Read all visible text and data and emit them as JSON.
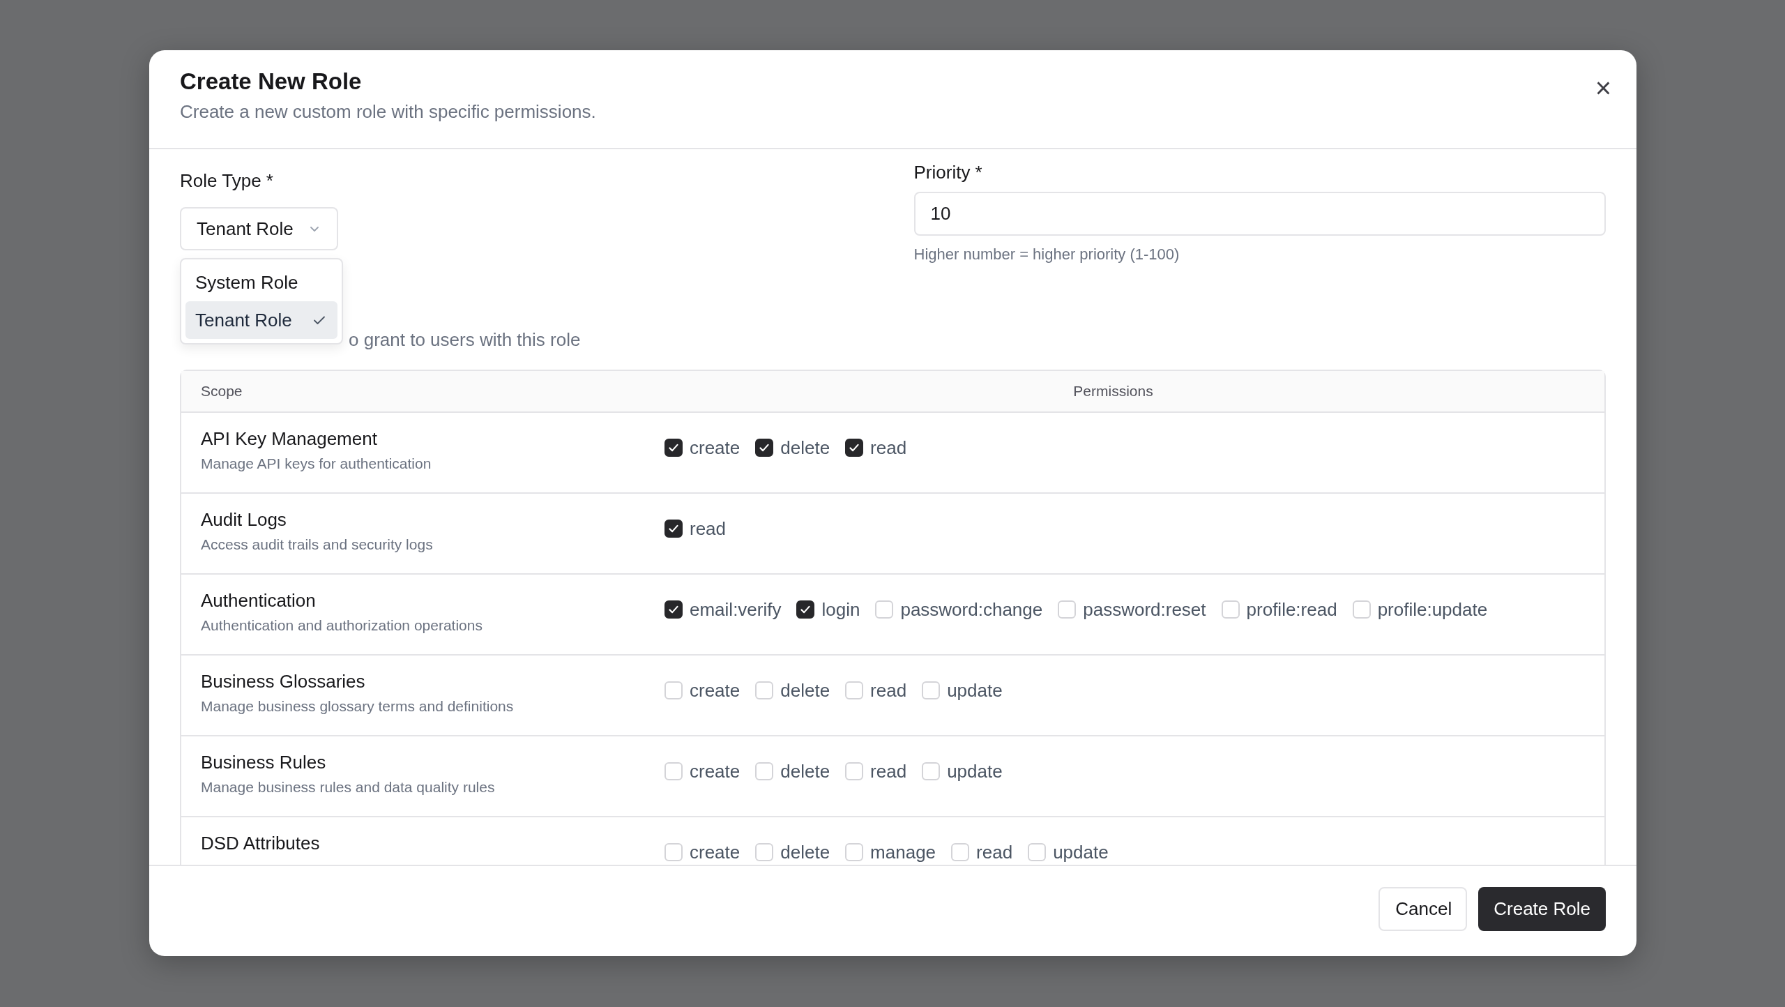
{
  "dialog": {
    "title": "Create New Role",
    "subtitle": "Create a new custom role with specific permissions.",
    "close": "×"
  },
  "role_type": {
    "label": "Role Type *",
    "value": "Tenant Role",
    "options": [
      {
        "label": "System Role",
        "selected": false
      },
      {
        "label": "Tenant Role",
        "selected": true
      }
    ]
  },
  "priority": {
    "label": "Priority *",
    "value": "10",
    "help": "Higher number = higher priority (1-100)"
  },
  "permissions_hint": "o grant to users with this role",
  "table": {
    "columns": [
      "Scope",
      "Permissions"
    ],
    "rows": [
      {
        "name": "API Key Management",
        "description": "Manage API keys for authentication",
        "permissions": [
          {
            "label": "create",
            "checked": true
          },
          {
            "label": "delete",
            "checked": true
          },
          {
            "label": "read",
            "checked": true
          }
        ]
      },
      {
        "name": "Audit Logs",
        "description": "Access audit trails and security logs",
        "permissions": [
          {
            "label": "read",
            "checked": true
          }
        ]
      },
      {
        "name": "Authentication",
        "description": "Authentication and authorization operations",
        "permissions": [
          {
            "label": "email:verify",
            "checked": true
          },
          {
            "label": "login",
            "checked": true
          },
          {
            "label": "password:change",
            "checked": false
          },
          {
            "label": "password:reset",
            "checked": false
          },
          {
            "label": "profile:read",
            "checked": false
          },
          {
            "label": "profile:update",
            "checked": false
          }
        ]
      },
      {
        "name": "Business Glossaries",
        "description": "Manage business glossary terms and definitions",
        "permissions": [
          {
            "label": "create",
            "checked": false
          },
          {
            "label": "delete",
            "checked": false
          },
          {
            "label": "read",
            "checked": false
          },
          {
            "label": "update",
            "checked": false
          }
        ]
      },
      {
        "name": "Business Rules",
        "description": "Manage business rules and data quality rules",
        "permissions": [
          {
            "label": "create",
            "checked": false
          },
          {
            "label": "delete",
            "checked": false
          },
          {
            "label": "read",
            "checked": false
          },
          {
            "label": "update",
            "checked": false
          }
        ]
      },
      {
        "name": "DSD Attributes",
        "permissions": [
          {
            "label": "create",
            "checked": false
          },
          {
            "label": "delete",
            "checked": false
          },
          {
            "label": "manage",
            "checked": false
          },
          {
            "label": "read",
            "checked": false
          },
          {
            "label": "update",
            "checked": false
          }
        ]
      }
    ]
  },
  "buttons": [
    {
      "label": "Cancel",
      "kind": "secondary"
    },
    {
      "label": "Create Role",
      "kind": "primary"
    }
  ]
}
